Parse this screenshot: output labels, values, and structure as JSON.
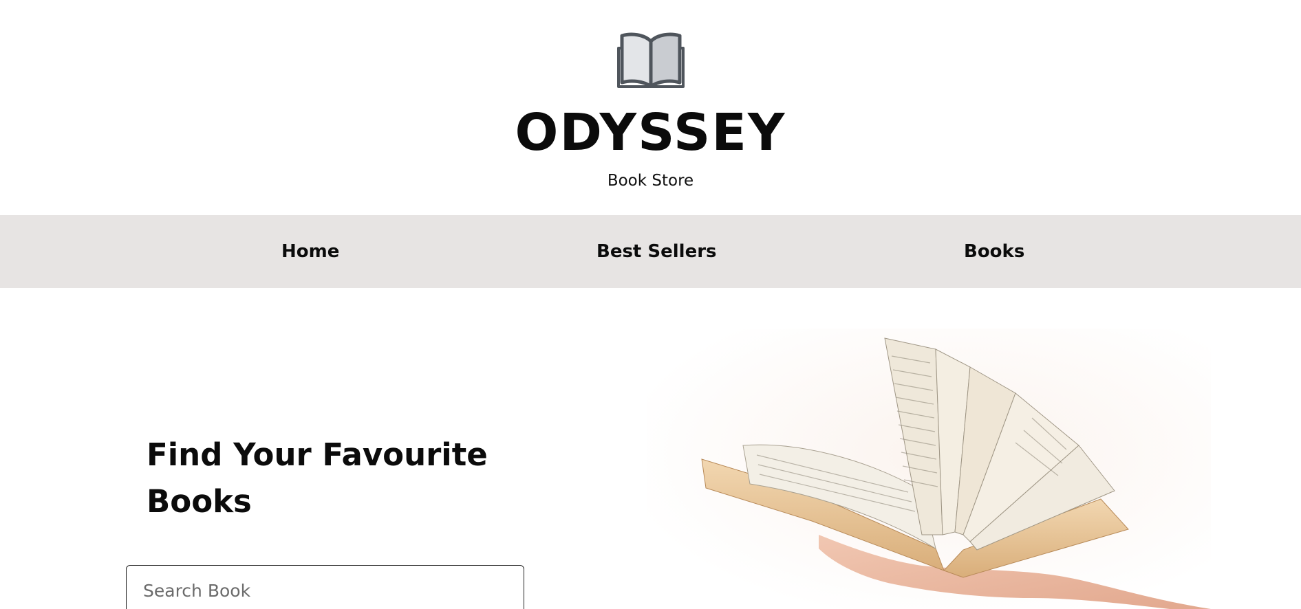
{
  "header": {
    "logo_icon": "open-book-icon",
    "brand": "ODYSSEY",
    "tagline": "Book Store"
  },
  "nav": {
    "items": [
      {
        "label": "Home"
      },
      {
        "label": "Best Sellers"
      },
      {
        "label": "Books"
      }
    ],
    "background": "#e7e4e3"
  },
  "hero": {
    "title": "Find Your Favourite Books",
    "search_placeholder": "Search Book",
    "search_value": "",
    "image": "hand-holding-open-book"
  },
  "colors": {
    "text": "#0b0b0b",
    "page_bg": "#ffffff",
    "book_pages": "#e9c79c"
  }
}
